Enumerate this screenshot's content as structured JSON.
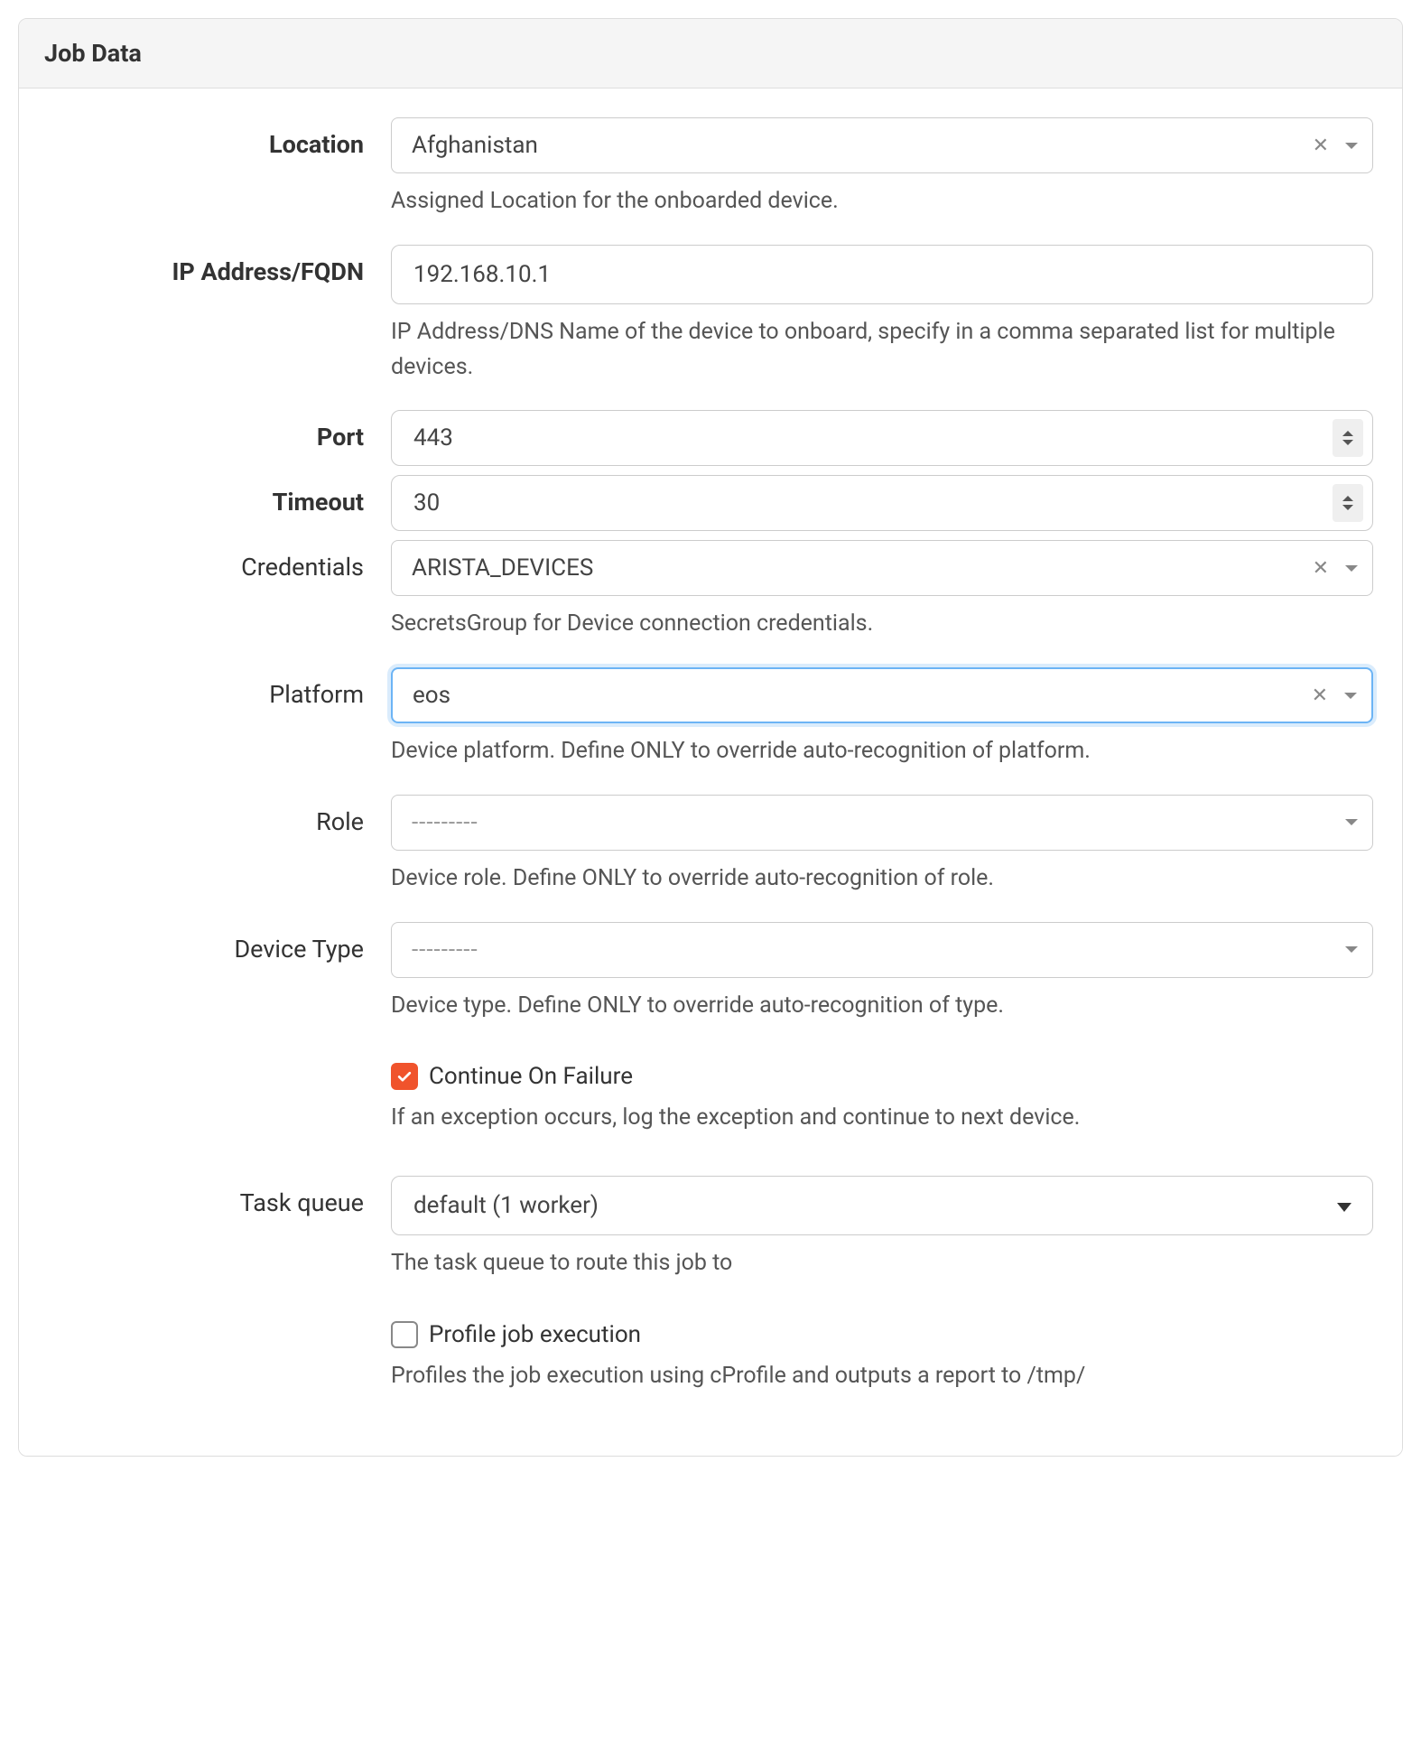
{
  "panel": {
    "title": "Job Data"
  },
  "fields": {
    "location": {
      "label": "Location",
      "value": "Afghanistan",
      "help": "Assigned Location for the onboarded device."
    },
    "ip": {
      "label": "IP Address/FQDN",
      "value": "192.168.10.1",
      "help": "IP Address/DNS Name of the device to onboard, specify in a comma separated list for multiple devices."
    },
    "port": {
      "label": "Port",
      "value": "443"
    },
    "timeout": {
      "label": "Timeout",
      "value": "30"
    },
    "credentials": {
      "label": "Credentials",
      "value": "ARISTA_DEVICES",
      "help": "SecretsGroup for Device connection credentials."
    },
    "platform": {
      "label": "Platform",
      "value": "eos",
      "help": "Device platform. Define ONLY to override auto-recognition of platform."
    },
    "role": {
      "label": "Role",
      "placeholder": "---------",
      "help": "Device role. Define ONLY to override auto-recognition of role."
    },
    "devicetype": {
      "label": "Device Type",
      "placeholder": "---------",
      "help": "Device type. Define ONLY to override auto-recognition of type."
    },
    "continue": {
      "label": "Continue On Failure",
      "help": "If an exception occurs, log the exception and continue to next device."
    },
    "taskqueue": {
      "label": "Task queue",
      "value": "default (1 worker)",
      "help": "The task queue to route this job to"
    },
    "profile": {
      "label": "Profile job execution",
      "help": "Profiles the job execution using cProfile and outputs a report to /tmp/"
    }
  }
}
